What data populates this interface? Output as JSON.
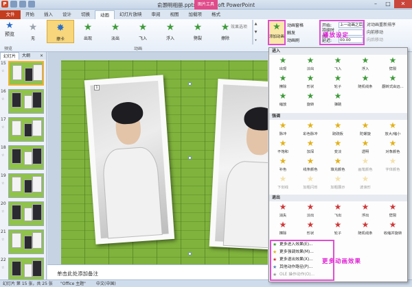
{
  "window": {
    "title": "俞灏明相册.pptx - Microsoft PowerPoint",
    "tool_tab_header": "图片工具",
    "min": "–",
    "max": "□",
    "close": "✕"
  },
  "tabs": [
    "文件",
    "开始",
    "插入",
    "设计",
    "切换",
    "动画",
    "幻灯片放映",
    "审阅",
    "视图",
    "加载项",
    "格式"
  ],
  "ribbon": {
    "preview_label": "预览",
    "group_preview": "预览",
    "group_animation": "动画",
    "gallery": [
      {
        "label": "无",
        "icon": "star-gray",
        "color": "#9aa3ad"
      },
      {
        "label": "擦卡",
        "icon": "star-burst",
        "color": "#2a6fc9",
        "selected": true
      },
      {
        "label": "出现",
        "icon": "star-green",
        "color": "#3f9b3a"
      },
      {
        "label": "淡出",
        "icon": "star-green",
        "color": "#3f9b3a"
      },
      {
        "label": "飞入",
        "icon": "star-green",
        "color": "#3f9b3a"
      },
      {
        "label": "浮入",
        "icon": "star-green",
        "color": "#3f9b3a"
      },
      {
        "label": "劈裂",
        "icon": "star-green",
        "color": "#3f9b3a"
      },
      {
        "label": "擦除",
        "icon": "star-green",
        "color": "#3f9b3a"
      }
    ],
    "effect_options": "效果选项",
    "add_animation": "添加动画",
    "animation_pane": "动画窗格",
    "trigger": "触发",
    "animation_painter": "动画刷",
    "start_label": "开始:",
    "start_value": "上一动画之后",
    "duration_label": "持续时间:",
    "duration_value": "",
    "delay_label": "延迟:",
    "delay_value": "00.00",
    "reorder_title": "对动画重新排序",
    "move_earlier": "向前移动",
    "move_later": "向后移动",
    "annotation_timing": "播放设定"
  },
  "slide_panel": {
    "tab_slides": "幻灯片",
    "tab_outline": "大纲",
    "close": "×",
    "thumbnails": [
      {
        "num": "15"
      },
      {
        "num": "16"
      },
      {
        "num": "17"
      },
      {
        "num": "18"
      },
      {
        "num": "19"
      },
      {
        "num": "20"
      },
      {
        "num": "21"
      },
      {
        "num": "22"
      }
    ]
  },
  "notes_placeholder": "单击此处添加备注",
  "status": {
    "slide_info": "幻灯片 第 15 张，共 25 张",
    "theme": "\"Office 主题\"",
    "language": "中文(中国)"
  },
  "dropdown": {
    "sections": [
      {
        "title": "进入",
        "items": [
          {
            "label": "出现",
            "color": "#3f9b3a"
          },
          {
            "label": "淡出",
            "color": "#3f9b3a"
          },
          {
            "label": "飞入",
            "color": "#3f9b3a"
          },
          {
            "label": "浮入",
            "color": "#3f9b3a"
          },
          {
            "label": "劈裂",
            "color": "#3f9b3a"
          },
          {
            "label": "擦除",
            "color": "#3f9b3a"
          },
          {
            "label": "形状",
            "color": "#3f9b3a"
          },
          {
            "label": "轮子",
            "color": "#3f9b3a"
          },
          {
            "label": "随机线条",
            "color": "#3f9b3a"
          },
          {
            "label": "翻转式由远...",
            "color": "#3f9b3a"
          },
          {
            "label": "缩放",
            "color": "#3f9b3a"
          },
          {
            "label": "旋转",
            "color": "#3f9b3a"
          },
          {
            "label": "弹跳",
            "color": "#3f9b3a"
          }
        ]
      },
      {
        "title": "强调",
        "items": [
          {
            "label": "脉冲",
            "color": "#e3b21b"
          },
          {
            "label": "彩色脉冲",
            "color": "#e3b21b"
          },
          {
            "label": "跷跷板",
            "color": "#e3b21b"
          },
          {
            "label": "陀螺旋",
            "color": "#e3b21b"
          },
          {
            "label": "放大/缩小",
            "color": "#e3b21b"
          },
          {
            "label": "不饱和",
            "color": "#e3b21b"
          },
          {
            "label": "加深",
            "color": "#e3b21b"
          },
          {
            "label": "变淡",
            "color": "#e3b21b"
          },
          {
            "label": "透明",
            "color": "#e3b21b"
          },
          {
            "label": "对象颜色",
            "color": "#e3b21b"
          },
          {
            "label": "补色",
            "color": "#e3b21b"
          },
          {
            "label": "线条颜色",
            "color": "#e3b21b"
          },
          {
            "label": "填充颜色",
            "color": "#e3b21b"
          },
          {
            "label": "画笔颜色",
            "color": "#e3b21b",
            "disabled": true
          },
          {
            "label": "字体颜色",
            "color": "#e3b21b",
            "disabled": true
          },
          {
            "label": "下划线",
            "color": "#e3b21b",
            "disabled": true
          },
          {
            "label": "加粗闪烁",
            "color": "#e3b21b",
            "disabled": true
          },
          {
            "label": "加粗展示",
            "color": "#e3b21b",
            "disabled": true
          },
          {
            "label": "波浪形",
            "color": "#e3b21b",
            "disabled": true
          }
        ]
      },
      {
        "title": "退出",
        "items": [
          {
            "label": "消失",
            "color": "#d0393a"
          },
          {
            "label": "淡出",
            "color": "#d0393a"
          },
          {
            "label": "飞出",
            "color": "#d0393a"
          },
          {
            "label": "浮出",
            "color": "#d0393a"
          },
          {
            "label": "劈裂",
            "color": "#d0393a"
          },
          {
            "label": "擦除",
            "color": "#d0393a"
          },
          {
            "label": "形状",
            "color": "#d0393a"
          },
          {
            "label": "轮子",
            "color": "#d0393a"
          },
          {
            "label": "随机线条",
            "color": "#d0393a"
          },
          {
            "label": "收缩并旋转",
            "color": "#d0393a"
          }
        ]
      }
    ],
    "more": [
      {
        "label": "更多进入效果(E)...",
        "color": "#3f9b3a"
      },
      {
        "label": "更多强调效果(M)...",
        "color": "#e3b21b"
      },
      {
        "label": "更多退出效果(X)...",
        "color": "#d0393a"
      },
      {
        "label": "其他动作路径(P)...",
        "color": "#5a7fb5"
      },
      {
        "label": "OLE 操作动作(O)...",
        "color": "#999999",
        "disabled": true
      }
    ],
    "annotation_more": "更多动画效果"
  }
}
